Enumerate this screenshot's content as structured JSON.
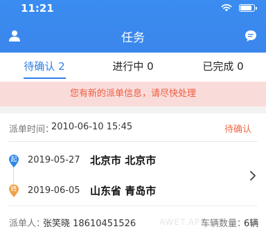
{
  "status_bar": {
    "time": "11:21"
  },
  "header": {
    "title": "任务"
  },
  "tabs": [
    {
      "label": "待确认 2",
      "active": true
    },
    {
      "label": "进行中 0",
      "active": false
    },
    {
      "label": "已完成 0",
      "active": false
    }
  ],
  "notice": {
    "text": "您有新的派单信息，请尽快处理"
  },
  "order": {
    "dispatch_label": "派单时间：",
    "dispatch_time": "2010-06-10 15:45",
    "status": "待确认",
    "start": {
      "marker": "起",
      "date": "2019-05-27",
      "city": "北京市 北京市"
    },
    "end": {
      "marker": "终",
      "date": "2019-06-05",
      "city": "山东省 青岛市"
    },
    "dispatcher_label": "派单人：",
    "dispatcher_value": "张笑晓 18610451526",
    "vehicles_label": "车辆数量：",
    "vehicles_value": "6辆"
  },
  "watermark": "AWET.APP",
  "colors": {
    "primary": "#2d7fe6",
    "header": "#3a8cf0",
    "notice_bg": "#f9dcda",
    "notice_text": "#f05a3f",
    "start_pin": "#2f86e6",
    "end_pin": "#f0a04b"
  }
}
